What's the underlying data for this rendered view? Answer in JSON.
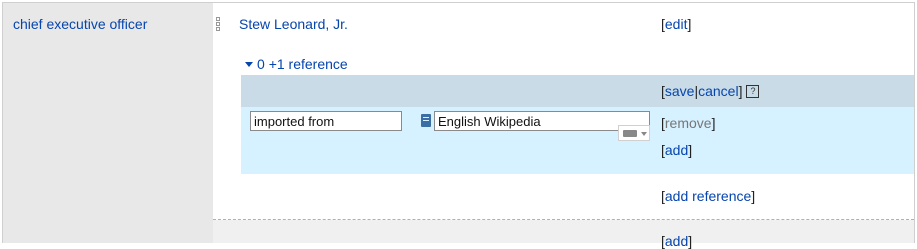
{
  "property": {
    "label": "chief executive officer"
  },
  "claim": {
    "value": "Stew Leonard, Jr.",
    "edit_label": "edit"
  },
  "references": {
    "toggle_count": "0",
    "toggle_text": "+1 reference"
  },
  "reference_editor": {
    "save_label": "save",
    "cancel_label": "cancel",
    "help_icon": "?",
    "property_value": "imported from",
    "entity_value": "English Wikipedia",
    "remove_label": "remove",
    "add_label": "add"
  },
  "add_reference_label": "add reference",
  "next_add_label": "add",
  "colors": {
    "link": "#0645ad",
    "property_bg": "#e8e8e8",
    "ref_header_bg": "#c8dbe7",
    "ref_body_bg": "#d6f1ff"
  }
}
